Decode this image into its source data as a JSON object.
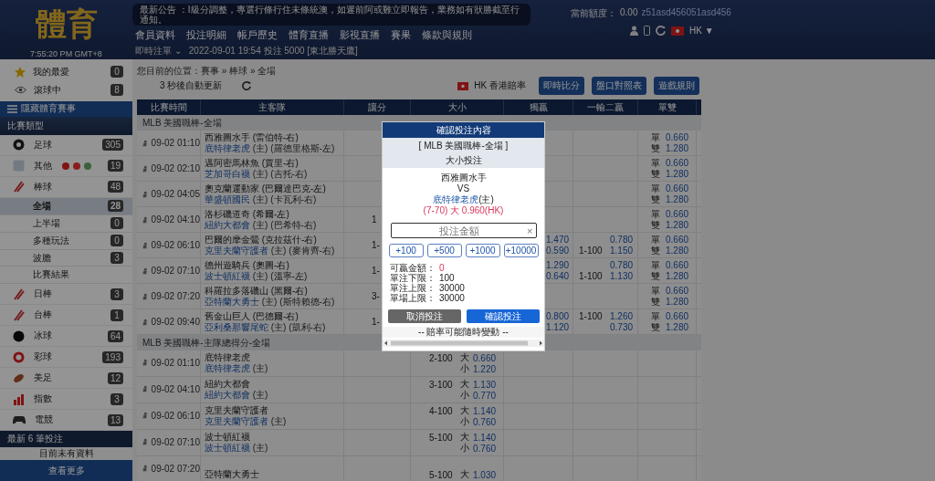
{
  "header": {
    "logo": "體育",
    "clock": "7:55:20 PM GMT+8",
    "announcement": "最新公告 ：I級分調整，專選行條行住未條統澳，如遲前阿或難立即報告，業務如有狀勝截至行通知。",
    "nav": [
      "會員資料",
      "投注明細",
      "帳戶歷史",
      "體育直播",
      "影視直播",
      "賽果",
      "條款與規則"
    ],
    "recent_label": "即時注單",
    "recent_caret": "⌄",
    "recent_text": "2022-09-01 19:54 投注 5000 [東北勝天鷹]",
    "balance_label": "當前額度：",
    "balance": "0.00",
    "username": "z51asd456051asd456",
    "language": "HK",
    "language_caret": "▼"
  },
  "sidebar": {
    "favorites": [
      {
        "kind": "star",
        "label": "我的最愛",
        "count": "0"
      },
      {
        "kind": "live",
        "label": "滾球中",
        "count": "8"
      }
    ],
    "hide_toggle": "隱藏體育賽事",
    "section_title": "比賽類型",
    "sports": [
      {
        "kind": "soccer",
        "label": "足球",
        "count": "305"
      },
      {
        "kind": "other",
        "label": "其他",
        "count": "19"
      },
      {
        "kind": "baseball",
        "label": "棒球",
        "count": "48",
        "children": [
          {
            "label": "全場",
            "count": "28",
            "selected": true
          },
          {
            "label": "上半場",
            "count": "0",
            "selected": false
          },
          {
            "label": "多種玩法",
            "count": "0",
            "selected": false
          },
          {
            "label": "波膽",
            "count": "3",
            "selected": false
          },
          {
            "label": "比賽結果",
            "selected": false
          }
        ]
      },
      {
        "kind": "baseball",
        "label": "日棒",
        "count": "3"
      },
      {
        "kind": "baseball",
        "label": "台棒",
        "count": "1"
      },
      {
        "kind": "hockey",
        "label": "冰球",
        "count": "64"
      },
      {
        "kind": "lottery",
        "label": "彩球",
        "count": "193"
      },
      {
        "kind": "football",
        "label": "美足",
        "count": "12"
      },
      {
        "kind": "index",
        "label": "指數",
        "count": "3"
      },
      {
        "kind": "esports",
        "label": "電競",
        "count": "13"
      }
    ],
    "recent_title": "最新 6 筆投注",
    "recent_empty": "目前未有資料",
    "more": "查看更多"
  },
  "main": {
    "breadcrumb": "您目前的位置：賽事 » 棒球 » 全場",
    "auto_refresh": "3 秒後自動更新",
    "odds_format": "HK 香港賠率",
    "buttons": [
      "即時比分",
      "盤口對照表",
      "遊戲規則"
    ],
    "table": {
      "columns": [
        "比賽時間",
        "主客隊",
        "讓分",
        "大小",
        "獨贏",
        "一輸二贏",
        "單雙"
      ],
      "leagues": [
        {
          "name": "MLB 美國職棒-全場",
          "rows": [
            {
              "time": "09-02 01:10",
              "away": "西雅圖水手 (雷伯特-右)",
              "home": "底特律老虎",
              "home_detail": "(主) (羅德里格斯-左)",
              "odd_even": [
                {
                  "label": "單",
                  "odds": "0.660"
                },
                {
                  "label": "雙",
                  "odds": "1.280"
                }
              ]
            },
            {
              "time": "09-02 02:10",
              "away": "邁阿密馬林魚 (賈里-右)",
              "home": "芝加哥白襪",
              "home_detail": "(主) (吉托-右)",
              "odd_even": [
                {
                  "label": "單",
                  "odds": "0.660"
                },
                {
                  "label": "雙",
                  "odds": "1.280"
                }
              ]
            },
            {
              "time": "09-02 04:05",
              "away": "奧克蘭運動家 (巴爾達巴克-左)",
              "home": "華盛頓國民",
              "home_detail": "(主) (卡瓦利-右)",
              "odd_even": [
                {
                  "label": "單",
                  "odds": "0.660"
                },
                {
                  "label": "雙",
                  "odds": "1.280"
                }
              ]
            },
            {
              "time": "09-02 04:10",
              "away": "洛杉磯道奇 (希爾-左)",
              "home": "紐約大都會",
              "home_detail": "(主) (巴希特-右)",
              "spread": "1",
              "odd_even": [
                {
                  "label": "單",
                  "odds": "0.660"
                },
                {
                  "label": "雙",
                  "odds": "1.280"
                }
              ]
            },
            {
              "time": "09-02 06:10",
              "away": "巴爾的摩金鶯 (克拉茲什-右)",
              "home": "克里夫蘭守護者",
              "home_detail": "(主) (麥肯齊-右)",
              "spread": "1-",
              "moneyline": [
                "1.470",
                "0.590"
              ],
              "one_two": [
                {
                  "odds": "0.780"
                },
                {
                  "line": "1-100",
                  "odds": "1.150"
                }
              ],
              "odd_even": [
                {
                  "label": "單",
                  "odds": "0.660"
                },
                {
                  "label": "雙",
                  "odds": "1.280"
                }
              ]
            },
            {
              "time": "09-02 07:10",
              "away": "德州遊騎兵 (奧圖-右)",
              "home": "波士頓紅襪",
              "home_detail": "(主) (溫寧-左)",
              "spread": "1-",
              "moneyline": [
                "1.290",
                "0.640"
              ],
              "one_two": [
                {
                  "odds": "0.780"
                },
                {
                  "line": "1-100",
                  "odds": "1.130"
                }
              ],
              "odd_even": [
                {
                  "label": "單",
                  "odds": "0.660"
                },
                {
                  "label": "雙",
                  "odds": "1.280"
                }
              ]
            },
            {
              "time": "09-02 07:20",
              "away": "科羅拉多落磯山 (黑爾-右)",
              "home": "亞特蘭大勇士",
              "home_detail": "(主) (斯特賴德-右)",
              "spread": "3-",
              "odd_even": [
                {
                  "label": "單",
                  "odds": "0.660"
                },
                {
                  "label": "雙",
                  "odds": "1.280"
                }
              ]
            },
            {
              "time": "09-02 09:40",
              "away": "舊金山巨人 (巴德爾-右)",
              "home": "亞利桑那響尾蛇",
              "home_detail": "(主) (凱利-右)",
              "spread": "1-",
              "moneyline": [
                "0.800",
                "1.120"
              ],
              "one_two": [
                {
                  "line": "1-100",
                  "odds": "1.260"
                },
                {
                  "odds": "0.730"
                }
              ],
              "odd_even": [
                {
                  "label": "單",
                  "odds": "0.660"
                },
                {
                  "label": "雙",
                  "odds": "1.280"
                }
              ]
            }
          ]
        },
        {
          "name": "MLB 美國職棒-主隊總得分-全場",
          "rows": [
            {
              "time": "09-02 01:10",
              "away": "底特律老虎",
              "home": "底特律老虎",
              "home_detail": "(主)",
              "total": [
                {
                  "line": "2-100",
                  "side": "大",
                  "odds": "0.660"
                },
                {
                  "side": "小",
                  "odds": "1.220"
                }
              ]
            },
            {
              "time": "09-02 04:10",
              "away": "紐約大都會",
              "home": "紐約大都會",
              "home_detail": "(主)",
              "total": [
                {
                  "line": "3-100",
                  "side": "大",
                  "odds": "1.130"
                },
                {
                  "side": "小",
                  "odds": "0.770"
                }
              ]
            },
            {
              "time": "09-02 06:10",
              "away": "克里夫蘭守護者",
              "home": "克里夫蘭守護者",
              "home_detail": "(主)",
              "total": [
                {
                  "line": "4-100",
                  "side": "大",
                  "odds": "1.140"
                },
                {
                  "side": "小",
                  "odds": "0.760"
                }
              ]
            },
            {
              "time": "09-02 07:10",
              "away": "波士頓紅襪",
              "home": "波士頓紅襪",
              "home_detail": "(主)",
              "total": [
                {
                  "line": "5-100",
                  "side": "大",
                  "odds": "1.140"
                },
                {
                  "side": "小",
                  "odds": "0.760"
                }
              ]
            },
            {
              "time": "09-02 07:20",
              "away": "亞特蘭大勇士",
              "total": [
                {
                  "line": "5-100",
                  "side": "大",
                  "odds": "1.030"
                }
              ]
            }
          ]
        }
      ]
    }
  },
  "bet_slip": {
    "title": "確認投注內容",
    "league": "[ MLB 美國職棒-全場 ]",
    "bet_type": "大小投注",
    "away": "西雅圖水手",
    "vs": "VS",
    "home": "底特律老虎",
    "home_tag": "(主)",
    "selection": "(7-70) 大 0.960(HK)",
    "amount": {
      "placeholder": "投注金額",
      "clear": "×"
    },
    "quick_amounts": [
      "+100",
      "+500",
      "+1000",
      "+10000"
    ],
    "limits": [
      {
        "kind": "win",
        "label": "可贏金額：",
        "value": "0"
      },
      {
        "kind": "plain",
        "label": "單注下限：",
        "value": "100"
      },
      {
        "kind": "plain",
        "label": "單注上限：",
        "value": "30000"
      },
      {
        "kind": "plain",
        "label": "單場上限：",
        "value": "30000"
      }
    ],
    "buttons": [
      {
        "kind": "cancel",
        "label": "取消投注"
      },
      {
        "kind": "confirm",
        "label": "確認投注"
      }
    ],
    "note": "-- 賠率可能隨時變動 --"
  }
}
